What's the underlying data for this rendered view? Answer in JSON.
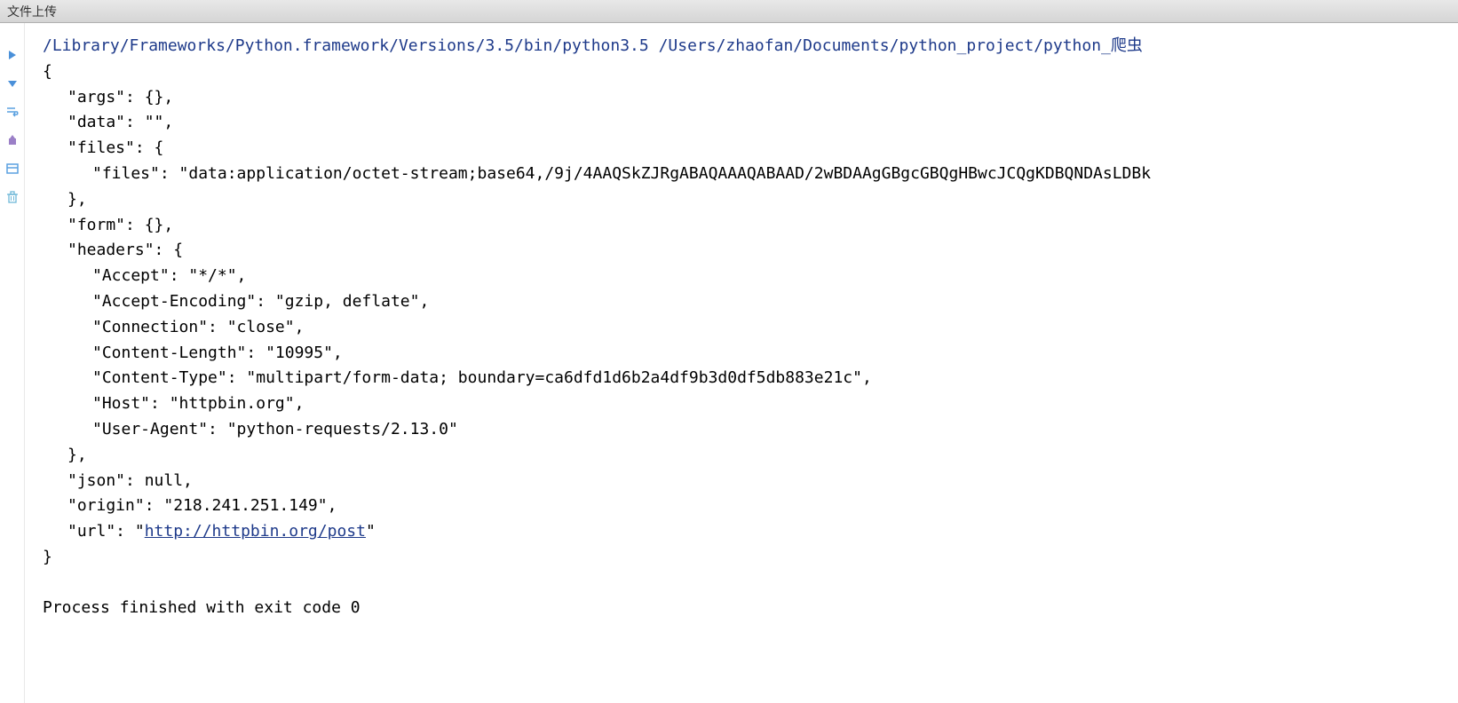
{
  "titleBar": {
    "title": "文件上传"
  },
  "console": {
    "commandLine": "/Library/Frameworks/Python.framework/Versions/3.5/bin/python3.5 /Users/zhaofan/Documents/python_project/python_爬虫",
    "jsonOutput": {
      "openBrace": "{",
      "args": "\"args\": {},",
      "data": "\"data\": \"\",",
      "filesOpen": "\"files\": {",
      "filesContent": "\"files\": \"data:application/octet-stream;base64,/9j/4AAQSkZJRgABAQAAAQABAAD/2wBDAAgGBgcGBQgHBwcJCQgKDBQNDAsLDBk",
      "filesClose": "},",
      "form": "\"form\": {},",
      "headersOpen": "\"headers\": {",
      "accept": "\"Accept\": \"*/*\",",
      "acceptEncoding": "\"Accept-Encoding\": \"gzip, deflate\",",
      "connection": "\"Connection\": \"close\",",
      "contentLength": "\"Content-Length\": \"10995\",",
      "contentType": "\"Content-Type\": \"multipart/form-data; boundary=ca6dfd1d6b2a4df9b3d0df5db883e21c\",",
      "host": "\"Host\": \"httpbin.org\",",
      "userAgent": "\"User-Agent\": \"python-requests/2.13.0\"",
      "headersClose": "},",
      "json": "\"json\": null,",
      "origin": "\"origin\": \"218.241.251.149\",",
      "urlPrefix": "\"url\": \"",
      "urlLink": "http://httpbin.org/post",
      "urlSuffix": "\"",
      "closeBrace": "}"
    },
    "processFinished": "Process finished with exit code 0"
  },
  "gutterIcons": {
    "run": "run-icon",
    "debug": "debug-icon",
    "stop": "stop-icon",
    "export": "export-icon",
    "layout": "layout-icon",
    "trash": "trash-icon"
  }
}
